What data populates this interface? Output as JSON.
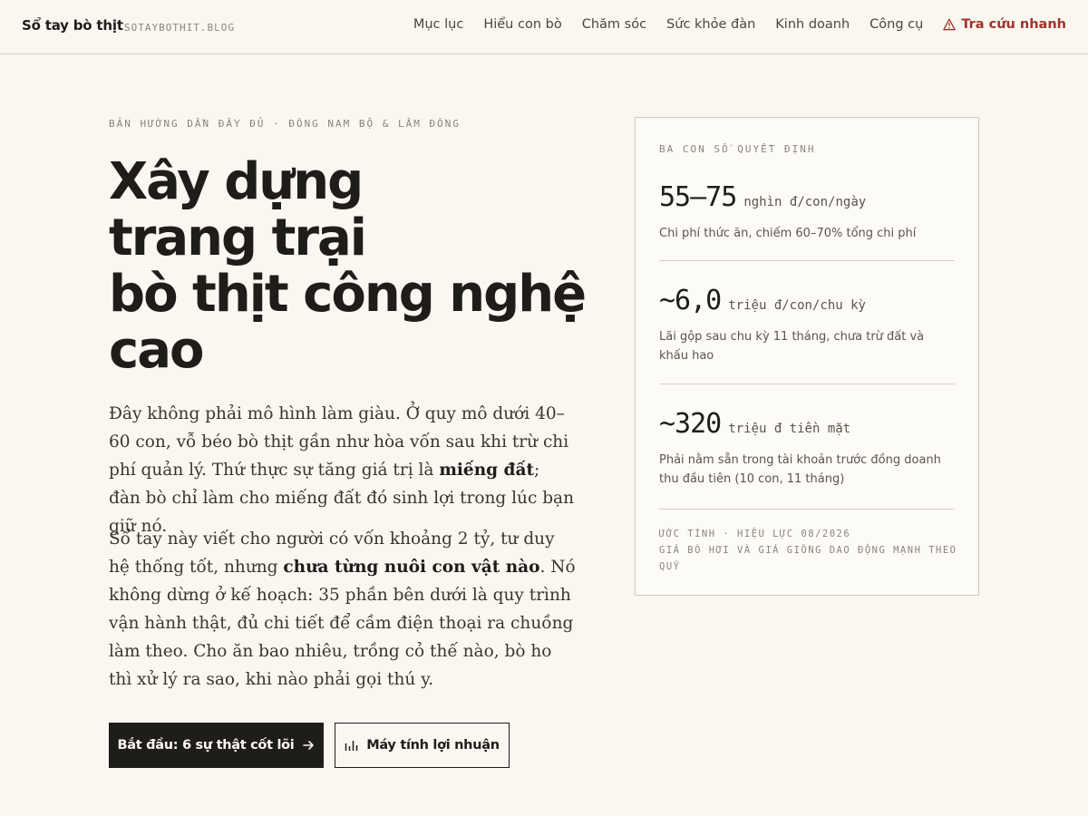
{
  "header": {
    "brand": "Sổ tay bò thịt",
    "domain": "SOTAYBOTHIT.BLOG",
    "nav": [
      {
        "label": "Mục lục"
      },
      {
        "label": "Hiểu con bò"
      },
      {
        "label": "Chăm sóc"
      },
      {
        "label": "Sức khỏe đàn"
      },
      {
        "label": "Kinh doanh"
      },
      {
        "label": "Công cụ"
      }
    ],
    "quick_lookup": "Tra cứu nhanh",
    "quick_lookup_color": "#a2322a"
  },
  "hero": {
    "eyebrow": "BẢN HƯỚNG DẪN ĐẦY ĐỦ · ĐÔNG NAM BỘ & LÂM ĐỒNG",
    "title_lines": [
      "Xây dựng",
      "trang trại",
      "bò thịt công nghệ",
      "cao"
    ],
    "p1": {
      "a": "Đây không phải mô hình làm giàu. Ở quy mô dưới 40–60 con, vỗ béo bò thịt gần như hòa vốn sau khi trừ chi phí quản lý. Thứ thực sự tăng giá trị là ",
      "b": "miếng đất",
      "c": "; đàn bò chỉ làm cho miếng đất đó sinh lợi trong lúc bạn giữ nó."
    },
    "p2": {
      "a": "Sổ tay này viết cho người có vốn khoảng 2 tỷ, tư duy hệ thống tốt, nhưng ",
      "b": "chưa từng nuôi con vật nào",
      "c": ". Nó không dừng ở kế hoạch: 35 phần bên dưới là quy trình vận hành thật, đủ chi tiết để cầm điện thoại ra chuồng làm theo. Cho ăn bao nhiêu, trồng cỏ thế nào, bò ho thì xử lý ra sao, khi nào phải gọi thú y."
    },
    "cta_primary": "Bắt đầu: 6 sự thật cốt lõi",
    "cta_secondary": "Máy tính lợi nhuận"
  },
  "card": {
    "label": "BA CON SỐ QUYẾT ĐỊNH",
    "stats": [
      {
        "value": "55–75",
        "unit": "nghìn đ/con/ngày",
        "desc": "Chi phí thức ăn, chiếm 60–70% tổng chi phí"
      },
      {
        "value": "~6,0",
        "unit": "triệu đ/con/chu kỳ",
        "desc": "Lãi gộp sau chu kỳ 11 tháng, chưa trừ đất và khấu hao"
      },
      {
        "value": "~320",
        "unit": "triệu đ tiền mặt",
        "desc": "Phải nằm sẵn trong tài khoản trước đồng doanh thu đầu tiên (10 con, 11 tháng)"
      }
    ],
    "footnote_1": "ƯỚC TÍNH · HIỆU LỰC 08/2026",
    "footnote_2": "GIÁ BÒ HƠI VÀ GIÁ GIỐNG DAO ĐỘNG MẠNH THEO QUÝ"
  }
}
